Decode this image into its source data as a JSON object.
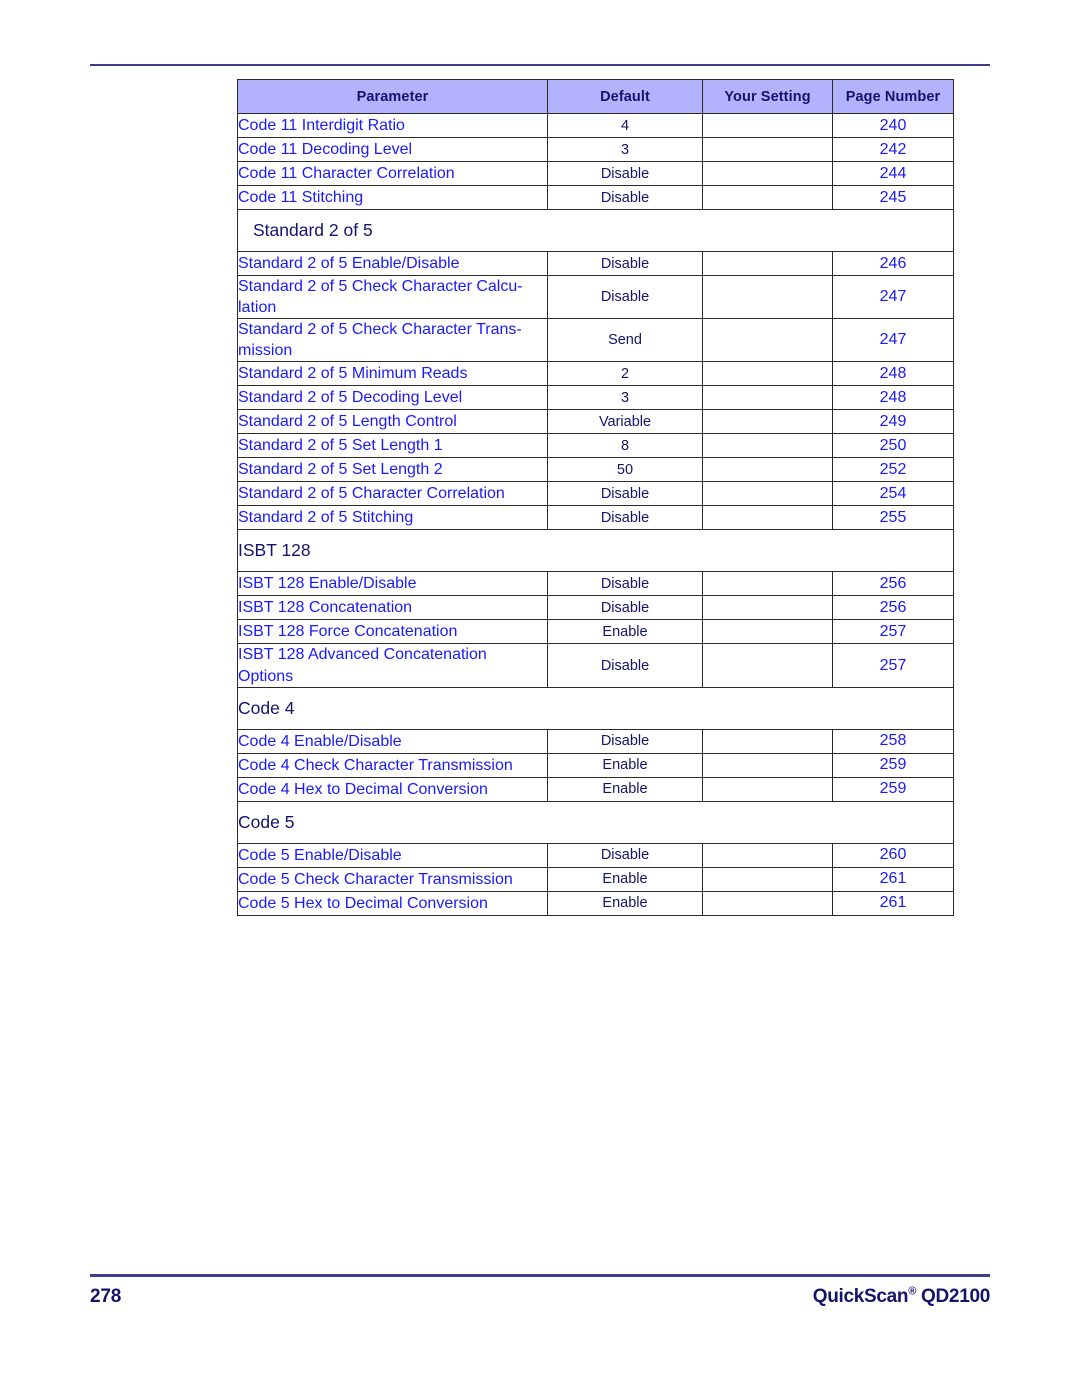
{
  "document": {
    "page_number": "278",
    "product_name": "QuickScan",
    "product_trademark": "®",
    "product_model": "QD2100"
  },
  "table": {
    "columns": [
      {
        "key": "parameter",
        "label": "Parameter"
      },
      {
        "key": "default",
        "label": "Default"
      },
      {
        "key": "setting",
        "label": "Your Setting"
      },
      {
        "key": "page",
        "label": "Page Number"
      }
    ],
    "header_background": "#b3b3fd",
    "header_text_color": "#14146b",
    "parameter_text_color": "#1a1aff",
    "value_text_color": "#14146b",
    "border_color": "#2a2a2a",
    "rows": [
      {
        "type": "data",
        "parameter": "Code 11 Interdigit Ratio",
        "default": "4",
        "setting": "",
        "page": "240"
      },
      {
        "type": "data",
        "parameter": "Code 11 Decoding Level",
        "default": "3",
        "setting": "",
        "page": "242"
      },
      {
        "type": "data",
        "parameter": "Code 11 Character Correlation",
        "default": "Disable",
        "setting": "",
        "page": "244"
      },
      {
        "type": "data",
        "parameter": "Code 11 Stitching",
        "default": "Disable",
        "setting": "",
        "page": "245"
      },
      {
        "type": "section",
        "title": "Standard 2 of 5"
      },
      {
        "type": "data",
        "parameter": "Standard 2 of 5 Enable/Disable",
        "default": "Disable",
        "setting": "",
        "page": "246"
      },
      {
        "type": "data",
        "parameter": "Standard 2 of 5 Check Character Calcu-\nlation",
        "default": "Disable",
        "setting": "",
        "page": "247"
      },
      {
        "type": "data",
        "parameter": "Standard 2 of 5 Check Character Trans-\nmission",
        "default": "Send",
        "setting": "",
        "page": "247"
      },
      {
        "type": "data",
        "parameter": "Standard 2 of 5 Minimum Reads",
        "default": "2",
        "setting": "",
        "page": "248"
      },
      {
        "type": "data",
        "parameter": "Standard 2 of 5 Decoding Level",
        "default": "3",
        "setting": "",
        "page": "248"
      },
      {
        "type": "data",
        "parameter": "Standard 2 of 5 Length Control",
        "default": "Variable",
        "setting": "",
        "page": "249"
      },
      {
        "type": "data",
        "parameter": "Standard 2 of 5 Set Length 1",
        "default": "8",
        "setting": "",
        "page": "250"
      },
      {
        "type": "data",
        "parameter": "Standard 2 of 5 Set Length 2",
        "default": "50",
        "setting": "",
        "page": "252"
      },
      {
        "type": "data",
        "parameter": "Standard 2 of 5 Character Correlation",
        "default": "Disable",
        "setting": "",
        "page": "254"
      },
      {
        "type": "data",
        "parameter": "Standard 2 of 5 Stitching",
        "default": "Disable",
        "setting": "",
        "page": "255"
      },
      {
        "type": "section",
        "title": "ISBT 128"
      },
      {
        "type": "data",
        "parameter": "ISBT 128 Enable/Disable",
        "default": "Disable",
        "setting": "",
        "page": "256"
      },
      {
        "type": "data",
        "parameter": "ISBT 128 Concatenation",
        "default": "Disable",
        "setting": "",
        "page": "256"
      },
      {
        "type": "data",
        "parameter": "ISBT 128 Force Concatenation",
        "default": "Enable",
        "setting": "",
        "page": "257"
      },
      {
        "type": "data",
        "parameter": "ISBT 128 Advanced Concatenation\nOptions",
        "default": "Disable",
        "setting": "",
        "page": "257"
      },
      {
        "type": "section",
        "title": "Code 4"
      },
      {
        "type": "data",
        "parameter": "Code 4 Enable/Disable",
        "default": "Disable",
        "setting": "",
        "page": "258"
      },
      {
        "type": "data",
        "parameter": "Code 4 Check Character Transmission",
        "default": "Enable",
        "setting": "",
        "page": "259"
      },
      {
        "type": "data",
        "parameter": "Code 4 Hex to Decimal Conversion",
        "default": "Enable",
        "setting": "",
        "page": "259"
      },
      {
        "type": "section",
        "title": "Code 5"
      },
      {
        "type": "data",
        "parameter": "Code 5 Enable/Disable",
        "default": "Disable",
        "setting": "",
        "page": "260"
      },
      {
        "type": "data",
        "parameter": "Code 5 Check Character Transmission",
        "default": "Enable",
        "setting": "",
        "page": "261"
      },
      {
        "type": "data",
        "parameter": "Code 5 Hex to Decimal Conversion",
        "default": "Enable",
        "setting": "",
        "page": "261"
      }
    ]
  }
}
